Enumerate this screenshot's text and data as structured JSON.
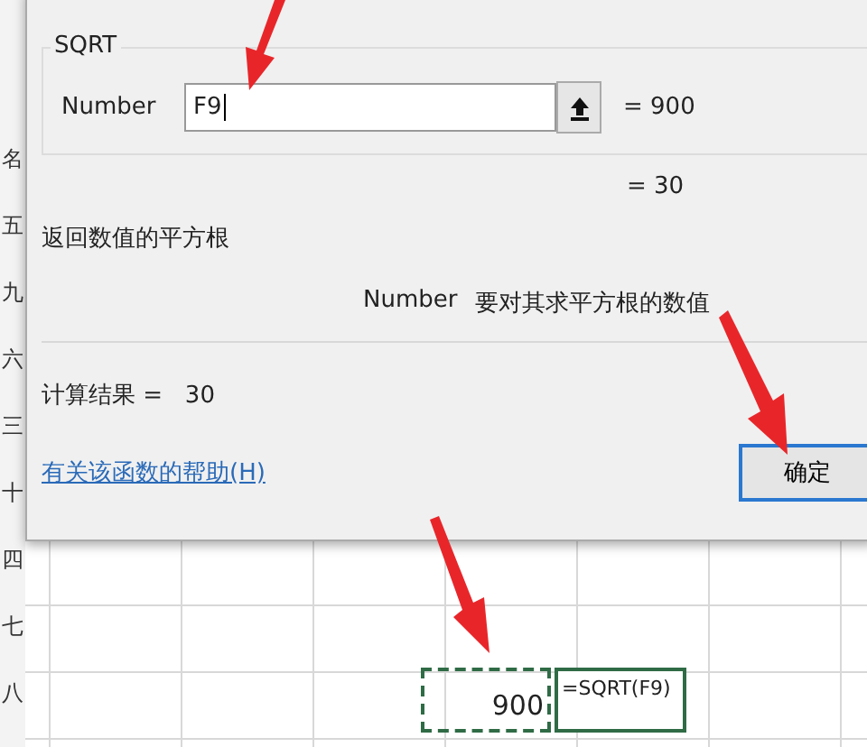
{
  "sheet": {
    "row_headers": [
      "名",
      "五",
      "九",
      "六",
      "三",
      "十",
      "四",
      "七",
      "八"
    ],
    "cells": [
      {
        "text": "900"
      },
      {
        "text": "=SQRT(F9)"
      }
    ]
  },
  "dialog": {
    "function_name": "SQRT",
    "argument": {
      "label": "Number",
      "value": "F9",
      "result": "= 900"
    },
    "formula_result": "= 30",
    "description": "返回数值的平方根",
    "argument_help": {
      "name": "Number",
      "text": "要对其求平方根的数值"
    },
    "calc_result": "计算结果 =   30",
    "help_link": "有关该函数的帮助(H)",
    "ok_button": "确定"
  }
}
